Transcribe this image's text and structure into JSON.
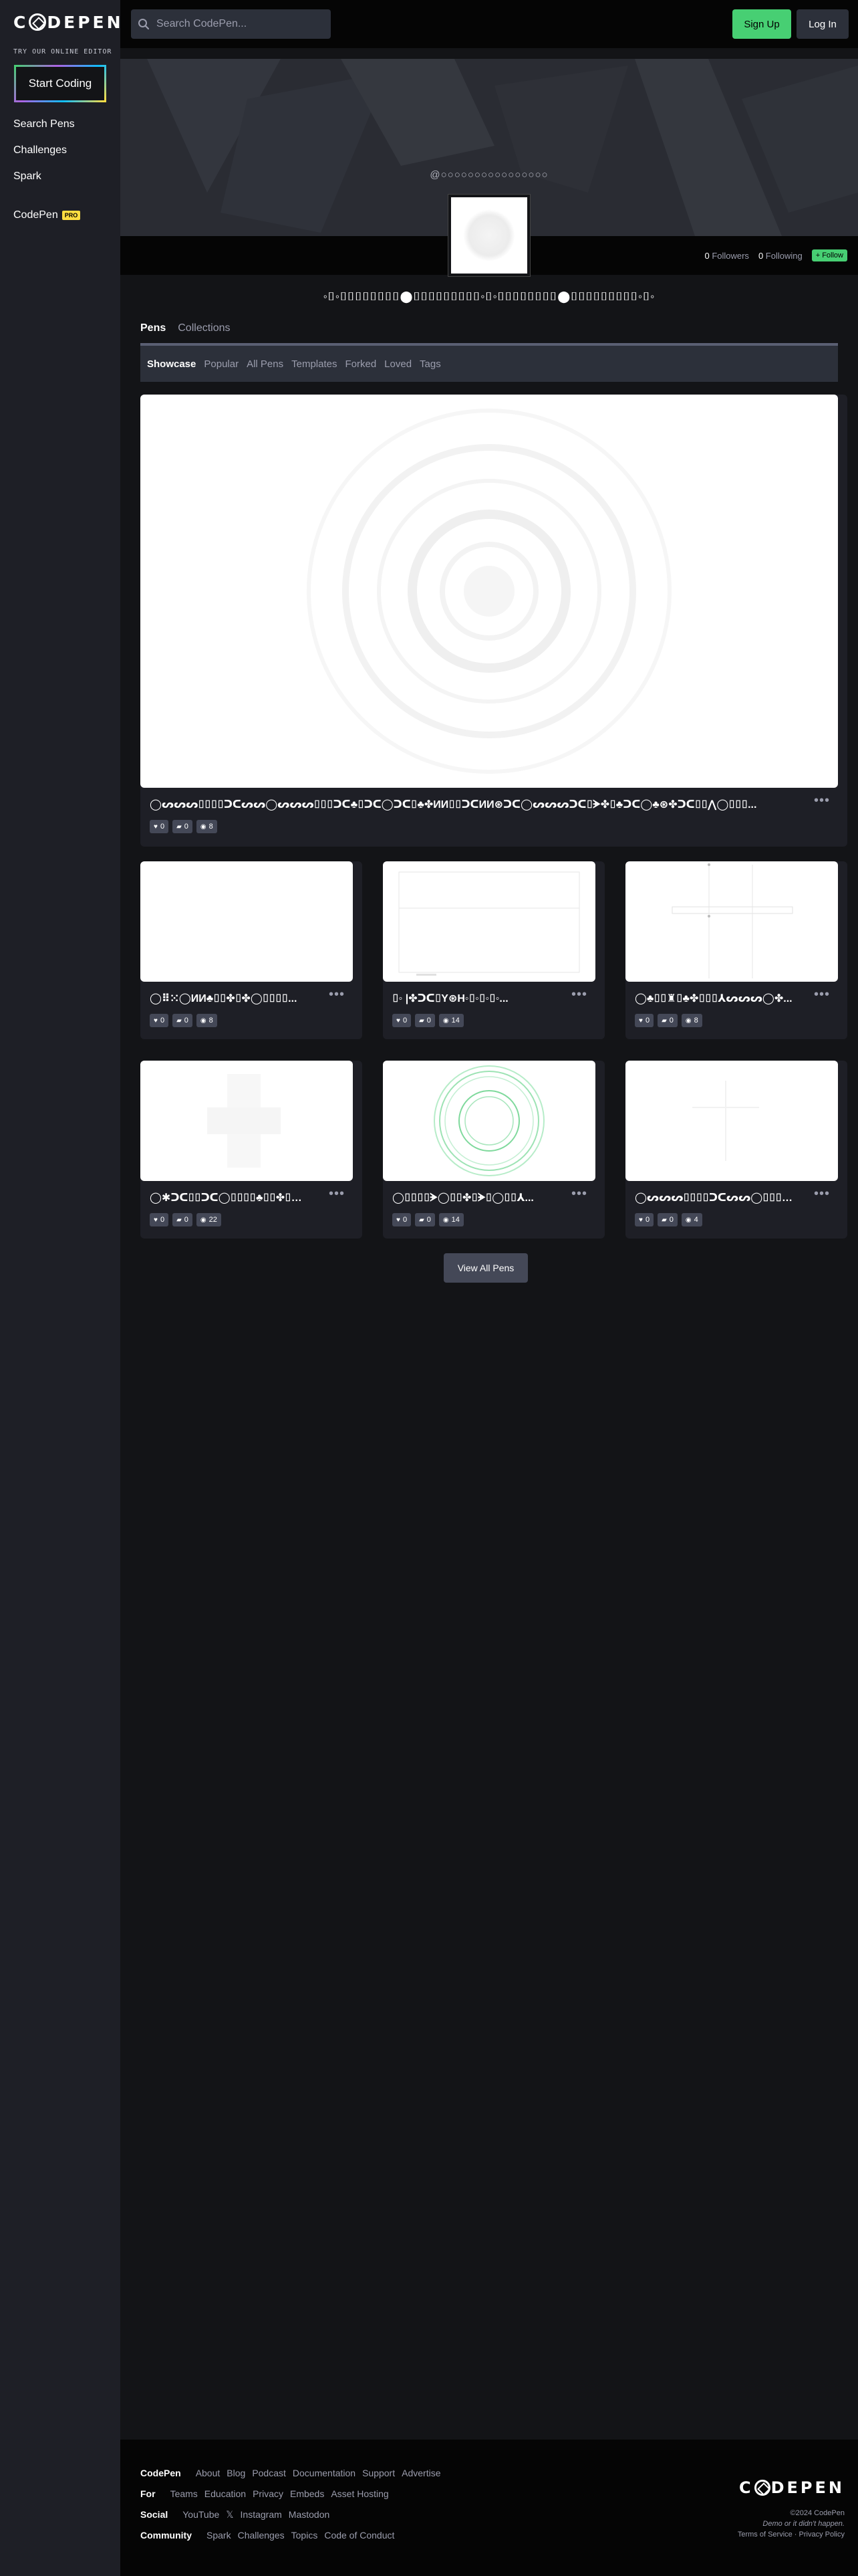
{
  "brand": {
    "logo_pre": "C",
    "logo_post": "DEPEN"
  },
  "sidebar": {
    "try_label": "TRY OUR ONLINE EDITOR",
    "start_coding": "Start Coding",
    "links": [
      "Search Pens",
      "Challenges",
      "Spark"
    ],
    "codepen_label": "CodePen",
    "pro_badge": "PRO"
  },
  "header": {
    "search_placeholder": "Search CodePen...",
    "signup": "Sign Up",
    "login": "Log In"
  },
  "profile": {
    "handle": "@○○○○○○○○○○○○○○○○",
    "followers_count": "0",
    "followers_label": "Followers",
    "following_count": "0",
    "following_label": "Following",
    "follow_button": "+ Follow",
    "display_name": "◦⌷◦⌷⌷⌷⌷⌷⌷⌷⌷⬤⌷⌷⌷⌷⌷⌷⌷⌷⌷◦⌷◦⌷⌷⌷⌷⌷⌷⌷⌷⬤⌷⌷⌷⌷⌷⌷⌷⌷⌷◦⌷◦"
  },
  "tabs": {
    "pens": "Pens",
    "collections": "Collections"
  },
  "subtabs": [
    "Showcase",
    "Popular",
    "All Pens",
    "Templates",
    "Forked",
    "Loved",
    "Tags"
  ],
  "pens": [
    {
      "title": "◯ᔕᔕᔕ⌷⌷⌷⌷ᑐᑕᔕᔕ◯ᔕᔕᔕ⌷⌷⌷ᑐᑕ♣⌷ᑐᑕ◯ᑐᑕ⌷♣✤ИИ⌷⌷ᑐᑕИИ⊛ᑐᑕ◯ᔕᔕᔕᑐᑕ⌷ᗘ✤⌷♣ᑐᑕ◯♣⊛✤ᑐᑕ⌷⌷⋀◯⌷⌷⌷...",
      "likes": "0",
      "comments": "0",
      "views": "8"
    },
    {
      "title": "◯⠿⁙◯ИИ♣⌷⌷✤⌷✤◯⌷⌷⌷⌷...",
      "likes": "0",
      "comments": "0",
      "views": "8"
    },
    {
      "title": "⌷◦ |✤ᑐᑕ⌷Y⊛H◦⌷◦⌷◦⌷◦...",
      "likes": "0",
      "comments": "0",
      "views": "14"
    },
    {
      "title": "◯♣⌷⌷♜⌷♣✤⌷⌷⌷⅄ᔕᔕᔕ◯✤...",
      "likes": "0",
      "comments": "0",
      "views": "8"
    },
    {
      "title": "◯✱ᑐᑕ⌷⌷ᑐᑕ◯⌷⌷⌷⌷♣⌷⌷✤⌷◯...",
      "likes": "0",
      "comments": "0",
      "views": "22"
    },
    {
      "title": "◯⌷⌷⌷⌷ᗘ◯⌷⌷✤⌷ᗘ⌷◯⌷⌷⅄...",
      "likes": "0",
      "comments": "0",
      "views": "14"
    },
    {
      "title": "◯ᔕᔕᔕ⌷⌷⌷⌷ᑐᑕᔕᔕ◯⌷⌷⌷⌷...",
      "likes": "0",
      "comments": "0",
      "views": "4"
    }
  ],
  "view_all": "View All Pens",
  "footer": {
    "rows": [
      {
        "label": "CodePen",
        "links": [
          "About",
          "Blog",
          "Podcast",
          "Documentation",
          "Support",
          "Advertise"
        ]
      },
      {
        "label": "For",
        "links": [
          "Teams",
          "Education",
          "Privacy",
          "Embeds",
          "Asset Hosting"
        ]
      },
      {
        "label": "Social",
        "links": [
          "YouTube",
          "𝕏",
          "Instagram",
          "Mastodon"
        ]
      },
      {
        "label": "Community",
        "links": [
          "Spark",
          "Challenges",
          "Topics",
          "Code of Conduct"
        ]
      }
    ],
    "copyright": "©2024 CodePen",
    "tagline": "Demo or it didn't happen.",
    "legal": "Terms of Service · Privacy Policy"
  }
}
